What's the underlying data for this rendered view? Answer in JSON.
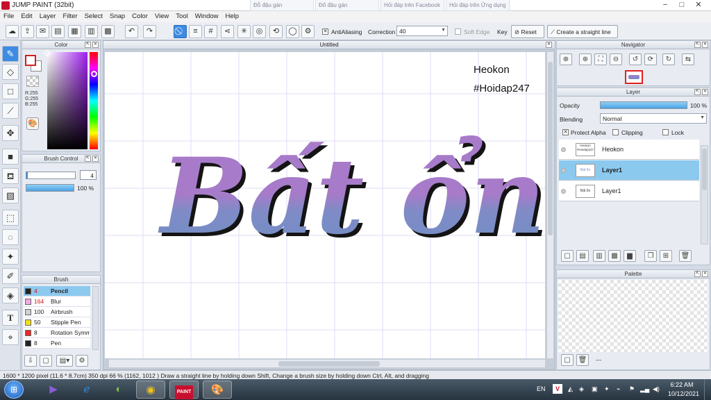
{
  "window": {
    "title": "JUMP PAINT (32bit)",
    "ghost_tabs": [
      "Đỗ đậu gán",
      "Đổ đậu gán",
      "Hỏi đáp trên Facebook",
      "Hỏi đáp trên Ửng dụng"
    ],
    "controls": [
      "−",
      "□",
      "✕"
    ]
  },
  "menu": [
    "File",
    "Edit",
    "Layer",
    "Filter",
    "Select",
    "Snap",
    "Color",
    "View",
    "Tool",
    "Window",
    "Help"
  ],
  "toolbar": {
    "antialiasing_label": "AntiAliasing",
    "correction_label": "Correction",
    "correction_value": "40",
    "soft_edge_label": "Soft Edge",
    "key_label": "Key",
    "reset_label": "Reset",
    "straight_line_label": "Create a straight line"
  },
  "color_panel": {
    "title": "Color",
    "rgb": [
      "R:255",
      "G:255",
      "B:255"
    ]
  },
  "brush_control": {
    "title": "Brush Control",
    "size_value": "4",
    "opacity_value": "100 %"
  },
  "brush_panel": {
    "title": "Brush",
    "items": [
      {
        "size": "4",
        "name": "Pencil",
        "color": "#222222",
        "selected": true
      },
      {
        "size": "164",
        "name": "Blur",
        "color": "#f3a8e8",
        "selected": false
      },
      {
        "size": "100",
        "name": "Airbrush",
        "color": "#d0d0d0",
        "selected": false
      },
      {
        "size": "50",
        "name": "Stipple Pen",
        "color": "#f2e01c",
        "selected": false
      },
      {
        "size": "8",
        "name": "Rotation Symm",
        "color": "#e82828",
        "selected": false
      },
      {
        "size": "8",
        "name": "Pen",
        "color": "#222222",
        "selected": false
      }
    ]
  },
  "canvas": {
    "tab_title": "Untitled",
    "watermark_line1": "Heokon",
    "watermark_line2": "#Hoidap247",
    "artwork_text": "Bất ổn",
    "gradient_top": "#a77bc9",
    "gradient_bottom": "#6f8fc4"
  },
  "navigator": {
    "title": "Navigator"
  },
  "layer_panel": {
    "title": "Layer",
    "opacity_label": "Opacity",
    "opacity_value": "100 %",
    "blending_label": "Blending",
    "blending_value": "Normal",
    "protect_alpha_label": "Protect Alpha",
    "clipping_label": "Clipping",
    "lock_label": "Lock",
    "layers": [
      {
        "name": "Heokon",
        "thumb_text": "Heokon #Hoidap247",
        "selected": false,
        "bold": false
      },
      {
        "name": "Layer1",
        "thumb_text": "Bất ổn",
        "selected": true,
        "bold": true
      },
      {
        "name": "Layer1",
        "thumb_text": "Bất ổn",
        "selected": false,
        "bold": false
      }
    ]
  },
  "palette_panel": {
    "title": "Palette",
    "footer_text": "---"
  },
  "status_bar": {
    "text": "1600 * 1200 pixel   (11.6 * 8.7cm)   350 dpi   66 %    (1162, 1012 )    Draw a straight line by holding down Shift, Change a brush size by holding down Ctrl, Alt, and dragging"
  },
  "taskbar": {
    "language": "EN",
    "time": "6:22 AM",
    "date": "10/12/2021"
  }
}
